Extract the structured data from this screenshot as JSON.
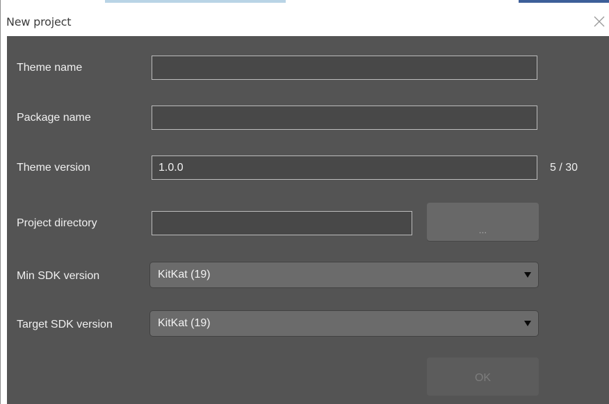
{
  "window": {
    "title": "New project",
    "close_icon": "close-icon"
  },
  "form": {
    "theme_name": {
      "label": "Theme name",
      "value": ""
    },
    "package_name": {
      "label": "Package name",
      "value": ""
    },
    "theme_version": {
      "label": "Theme version",
      "value": "1.0.0",
      "counter": "5 / 30"
    },
    "project_directory": {
      "label": "Project directory",
      "value": "",
      "browse_label": "..."
    },
    "min_sdk": {
      "label": "Min SDK version",
      "selected": "KitKat (19)"
    },
    "target_sdk": {
      "label": "Target SDK version",
      "selected": "KitKat (19)"
    },
    "ok_label": "OK"
  },
  "colors": {
    "panel_bg": "#545454",
    "field_bg": "#484848",
    "field_border": "#bdbdbd",
    "select_bg": "#6b6b6b",
    "label_text": "#f0f0f0"
  }
}
